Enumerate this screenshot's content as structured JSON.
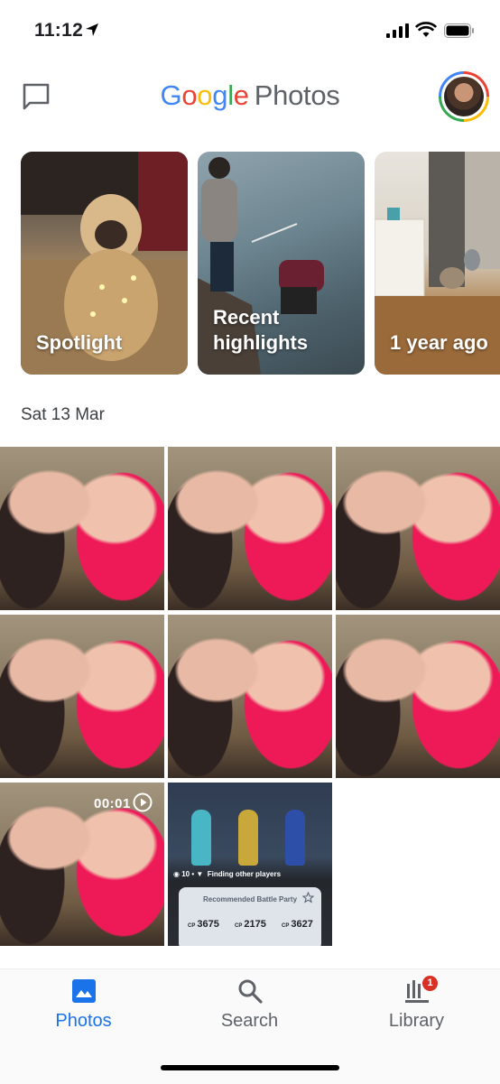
{
  "status_bar": {
    "time": "11:12"
  },
  "header": {
    "logo_google": [
      "G",
      "o",
      "o",
      "g",
      "l",
      "e"
    ],
    "logo_product": "Photos"
  },
  "memories": [
    {
      "label": "Spotlight"
    },
    {
      "label": "Recent highlights"
    },
    {
      "label": "1 year ago"
    }
  ],
  "section": {
    "date": "Sat 13 Mar"
  },
  "grid": {
    "video_duration": "00:01",
    "game_screenshot": {
      "status_text": "Finding other players",
      "status_count": "10",
      "panel_title": "Recommended Battle Party",
      "cp_prefix": "CP",
      "cp_values": [
        "3675",
        "2175",
        "3627"
      ]
    }
  },
  "nav": {
    "items": [
      {
        "label": "Photos",
        "icon": "photo-icon",
        "active": true
      },
      {
        "label": "Search",
        "icon": "search-icon",
        "active": false
      },
      {
        "label": "Library",
        "icon": "library-icon",
        "active": false
      }
    ],
    "library_badge": "1"
  },
  "colors": {
    "accent": "#1a73e8",
    "badge": "#d93025",
    "google_blue": "#4285F4",
    "google_red": "#EA4335",
    "google_yellow": "#FBBC05",
    "google_green": "#34A853"
  }
}
